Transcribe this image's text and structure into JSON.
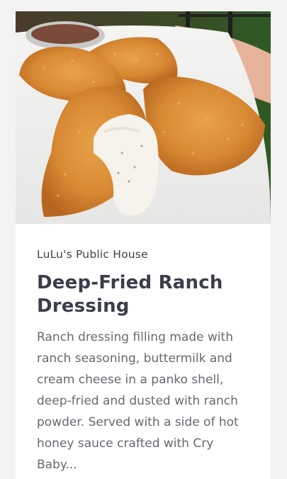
{
  "card": {
    "restaurant": "LuLu's Public House",
    "title": "Deep-Fried Ranch Dressing",
    "description": "Ranch dressing filling made with ranch seasoning, buttermilk and cream cheese in a panko shell, deep-fried and dusted with ranch powder. Served with a side of hot honey sauce crafted with Cry Baby..."
  }
}
